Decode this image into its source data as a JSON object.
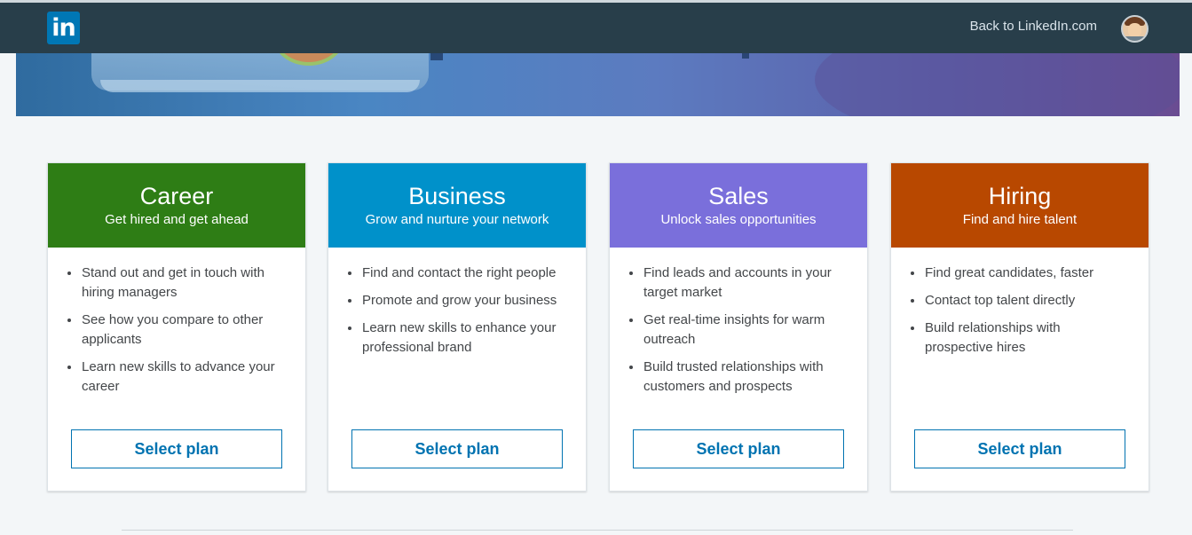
{
  "header": {
    "logo_text": "in",
    "back_link": "Back to LinkedIn.com"
  },
  "plans": [
    {
      "title": "Career",
      "subtitle": "Get hired and get ahead",
      "color": "#2e7d15",
      "bullets": [
        "Stand out and get in touch with hiring managers",
        "See how you compare to other applicants",
        "Learn new skills to advance your career"
      ],
      "button": "Select plan"
    },
    {
      "title": "Business",
      "subtitle": "Grow and nurture your network",
      "color": "#0091ca",
      "bullets": [
        "Find and contact the right people",
        "Promote and grow your business",
        "Learn new skills to enhance your professional brand"
      ],
      "button": "Select plan"
    },
    {
      "title": "Sales",
      "subtitle": "Unlock sales opportunities",
      "color": "#7a6fdb",
      "bullets": [
        "Find leads and accounts in your target market",
        "Get real-time insights for warm outreach",
        "Build trusted relationships with customers and prospects"
      ],
      "button": "Select plan"
    },
    {
      "title": "Hiring",
      "subtitle": "Find and hire talent",
      "color": "#b84800",
      "bullets": [
        "Find great candidates, faster",
        "Contact top talent directly",
        "Build relationships with prospective hires"
      ],
      "button": "Select plan"
    }
  ]
}
